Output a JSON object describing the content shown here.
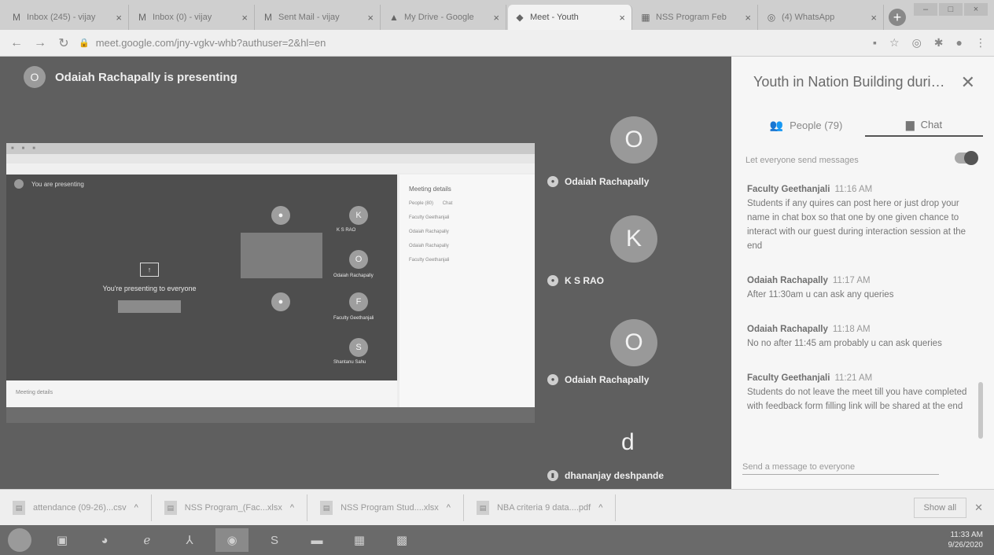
{
  "browser": {
    "tabs": [
      {
        "favicon": "gmail-icon",
        "glyph": "M",
        "label": "Inbox (245) - vijay"
      },
      {
        "favicon": "gmail-icon",
        "glyph": "M",
        "label": "Inbox (0) - vijay"
      },
      {
        "favicon": "gmail-icon",
        "glyph": "M",
        "label": "Sent Mail - vijay"
      },
      {
        "favicon": "drive-icon",
        "glyph": "▲",
        "label": "My Drive - Google"
      },
      {
        "favicon": "meet-icon",
        "glyph": "◆",
        "label": "Meet - Youth"
      },
      {
        "favicon": "sheets-icon",
        "glyph": "▦",
        "label": "NSS Program Feb"
      },
      {
        "favicon": "whatsapp-icon",
        "glyph": "◎",
        "label": "(4) WhatsApp"
      }
    ],
    "url": "meet.google.com/jny-vgkv-whb?authuser=2&hl=en"
  },
  "meet": {
    "presenting_initial": "O",
    "presenting_text": "Odaiah Rachapally is presenting",
    "shared_screen": {
      "you_presenting": "You are presenting",
      "presenting_to_everyone": "You're presenting to everyone",
      "meeting_details": "Meeting details",
      "chat_title": "Meeting details",
      "people_label": "People (80)",
      "chat_label": "Chat",
      "tiles": [
        {
          "initial": "K",
          "name": "K S RAO"
        },
        {
          "initial": "O",
          "name": "Odaiah Rachapally"
        },
        {
          "initial": "F",
          "name": "Faculty Geethanjali"
        },
        {
          "initial": "S",
          "name": "Shantanu Sahu"
        }
      ]
    },
    "participants": [
      {
        "initial": "O",
        "name": "Odaiah Rachapally"
      },
      {
        "initial": "K",
        "name": "K S RAO"
      },
      {
        "initial": "O",
        "name": "Odaiah Rachapally"
      },
      {
        "initial": "d",
        "name": "dhananjay deshpande"
      }
    ]
  },
  "panel": {
    "title": "Youth in Nation Building during C...",
    "tab_people": "People (79)",
    "tab_chat": "Chat",
    "toggle_label": "Let everyone send messages",
    "messages": [
      {
        "author": "Faculty Geethanjali",
        "time": "11:16 AM",
        "text": "Students if any quires can post here or just drop your name in chat box so that one by one given chance to interact with our guest during interaction session at the end"
      },
      {
        "author": "Odaiah Rachapally",
        "time": "11:17 AM",
        "text": "After 11:30am u can ask any queries"
      },
      {
        "author": "Odaiah Rachapally",
        "time": "11:18 AM",
        "text": "No no after 11:45 am probably u can ask queries"
      },
      {
        "author": "Faculty Geethanjali",
        "time": "11:21 AM",
        "text": "Students do not leave the meet till you have completed with feedback form filling link will be shared at the end"
      }
    ],
    "compose_placeholder": "Send a message to everyone"
  },
  "downloads": {
    "items": [
      {
        "label": "attendance (09-26)...csv"
      },
      {
        "label": "NSS Program_(Fac...xlsx"
      },
      {
        "label": "NSS Program Stud....xlsx"
      },
      {
        "label": "NBA criteria 9 data....pdf"
      }
    ],
    "show_all": "Show all"
  },
  "taskbar": {
    "time": "11:33 AM",
    "date": "9/26/2020"
  }
}
